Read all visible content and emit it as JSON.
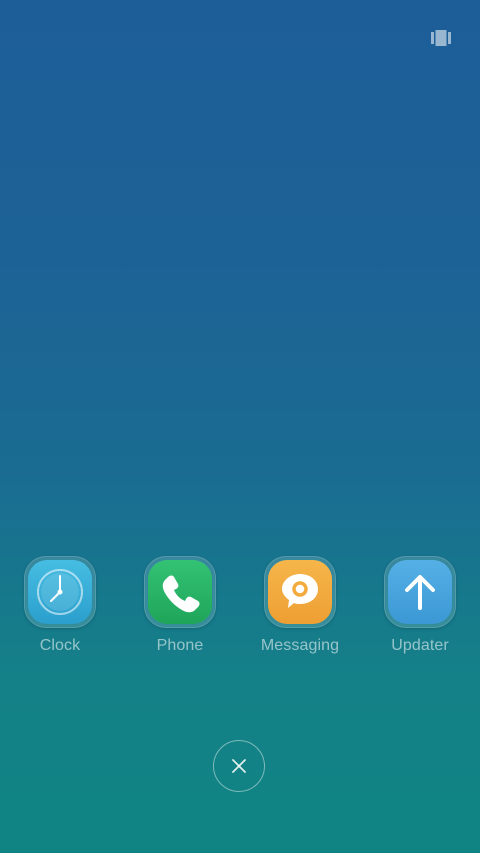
{
  "status_bar": {
    "recent_apps_icon": "recent-apps-icon"
  },
  "apps": [
    {
      "label": "Clock",
      "icon": "clock-icon",
      "color": "#3aaed3"
    },
    {
      "label": "Phone",
      "icon": "phone-icon",
      "color": "#2bb567"
    },
    {
      "label": "Messaging",
      "icon": "messaging-icon",
      "color": "#f2ab3f"
    },
    {
      "label": "Updater",
      "icon": "updater-icon",
      "color": "#4aa6de"
    }
  ],
  "close_button": {
    "icon": "close-icon"
  }
}
